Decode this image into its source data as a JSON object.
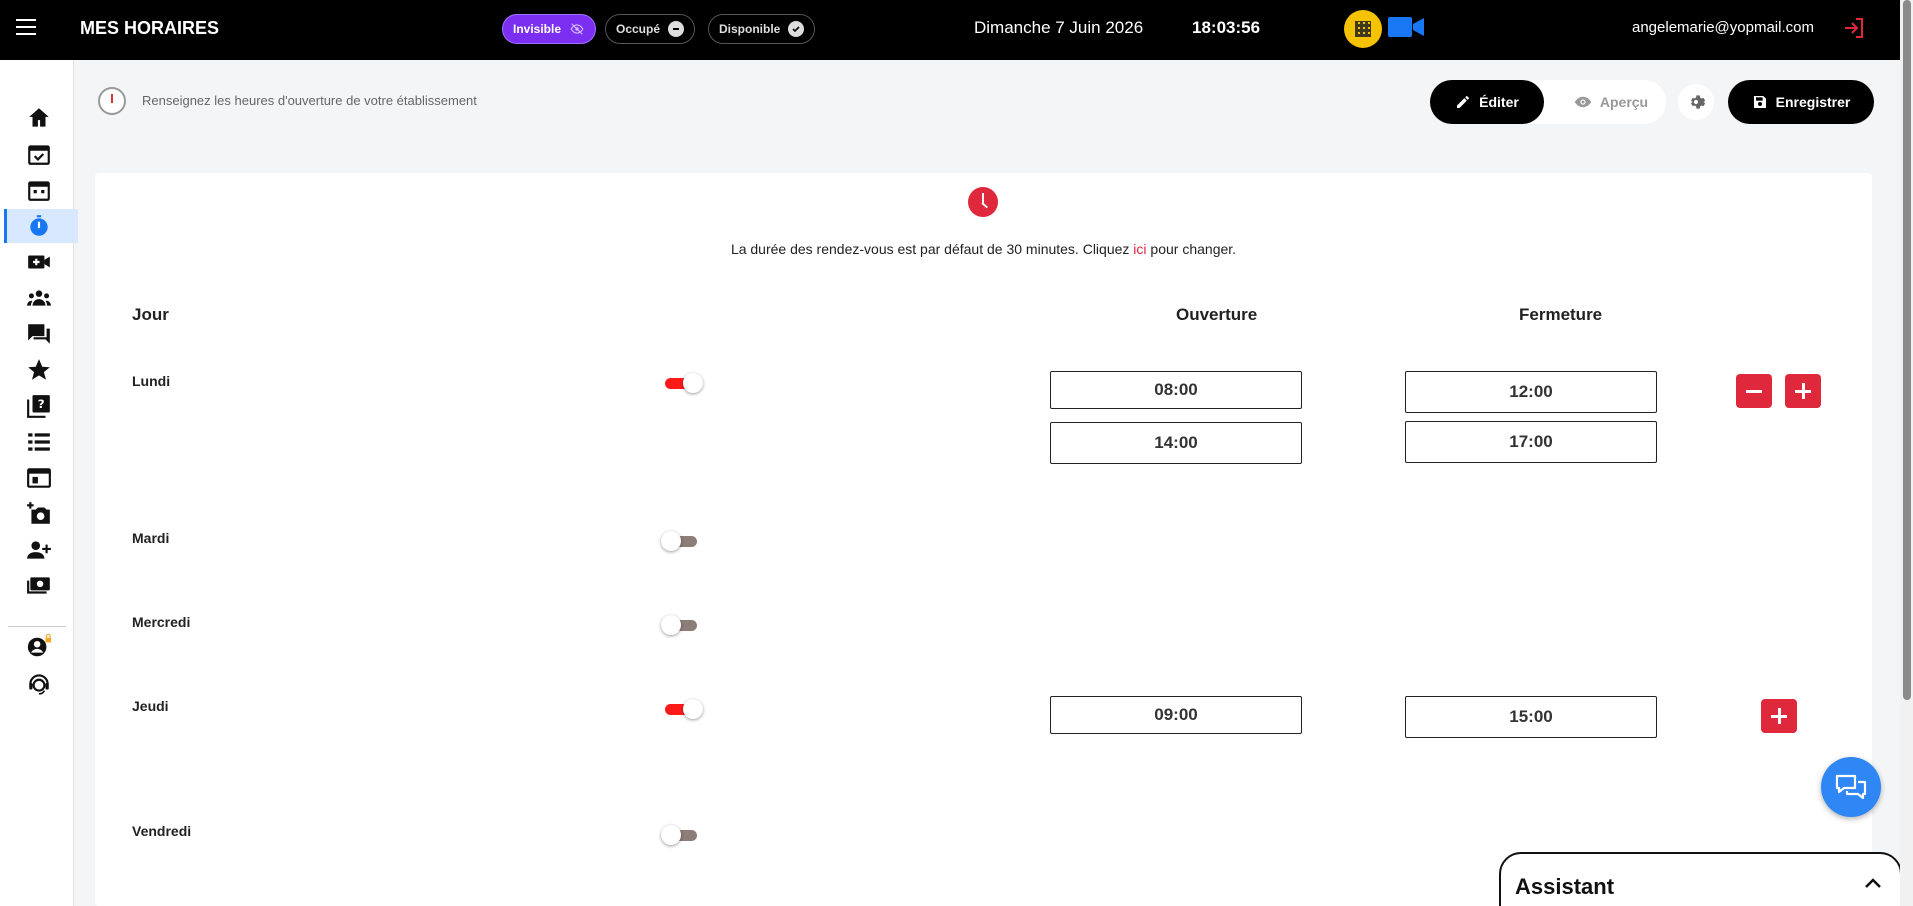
{
  "topbar": {
    "title": "MES HORAIRES",
    "statuses": [
      {
        "label": "Invisible",
        "active": true,
        "icon": "eye-off-icon"
      },
      {
        "label": "Occupé",
        "active": false,
        "icon": "minus-circle-icon"
      },
      {
        "label": "Disponible",
        "active": false,
        "icon": "check-circle-icon"
      }
    ],
    "date": "Dimanche 7 Juin 2026",
    "time": "18:03:56",
    "email": "angelemarie@yopmail.com",
    "colors": {
      "active_status": "#7b2ff0",
      "qr": "#f5c200",
      "video": "#1877f2",
      "logout": "#e0283c"
    }
  },
  "sidebar": {
    "items": [
      {
        "name": "home-icon"
      },
      {
        "name": "calendar-check-icon"
      },
      {
        "name": "calendar-icon"
      },
      {
        "name": "timer-icon",
        "active": true
      },
      {
        "name": "video-plus-icon"
      },
      {
        "name": "group-icon"
      },
      {
        "name": "chat-icon"
      },
      {
        "name": "star-icon"
      },
      {
        "name": "help-book-icon"
      },
      {
        "name": "list-icon"
      },
      {
        "name": "browser-icon"
      },
      {
        "name": "add-photo-icon"
      },
      {
        "name": "person-add-icon"
      },
      {
        "name": "payments-icon"
      },
      {
        "name": "account-lock-icon"
      },
      {
        "name": "support-agent-icon"
      }
    ]
  },
  "subheader": {
    "text": "Renseignez les heures d'ouverture de votre établissement",
    "edit_label": "Éditer",
    "preview_label": "Aperçu",
    "save_label": "Enregistrer"
  },
  "card": {
    "info_prefix": "La durée des rendez-vous est par défaut de 30 minutes. Cliquez ",
    "info_link": "ici",
    "info_suffix": " pour changer.",
    "headers": {
      "day": "Jour",
      "open": "Ouverture",
      "close": "Fermeture"
    },
    "days": [
      {
        "label": "Lundi",
        "enabled": true,
        "slots": [
          {
            "open": "08:00",
            "close": "12:00"
          },
          {
            "open": "14:00",
            "close": "17:00"
          }
        ]
      },
      {
        "label": "Mardi",
        "enabled": false,
        "slots": []
      },
      {
        "label": "Mercredi",
        "enabled": false,
        "slots": []
      },
      {
        "label": "Jeudi",
        "enabled": true,
        "slots": [
          {
            "open": "09:00",
            "close": "15:00"
          }
        ]
      },
      {
        "label": "Vendredi",
        "enabled": false,
        "slots": []
      }
    ],
    "colors": {
      "accent": "#e0283c",
      "toggle_on": "#ff1a1a",
      "toggle_off": "#8d7d78"
    }
  },
  "assistant": {
    "title": "Assistant"
  }
}
